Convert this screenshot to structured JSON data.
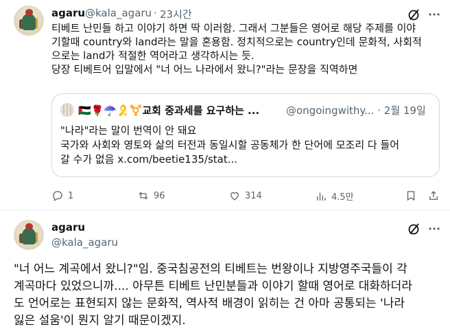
{
  "tweet1": {
    "name": "agaru",
    "handle": "@kala_agaru",
    "separator": "·",
    "time": "23시간",
    "lines": [
      "티베트 난민들 하고 이야기 하면 딱 이러함. 그래서 그분들은 영어로 해당 주제를 이야",
      "기할때 country와 land라는 말을 혼용함. 정치적으로는 country인데 문화적, 사회적",
      "으로는 land가 적절한 역어라고 생각하시는 듯.",
      "당장 티베트어 입말에서 \"너 어느 나라에서 왔니?\"라는 문장을 직역하면"
    ],
    "quote": {
      "name": "🇵🇸🌹☂️🎗️⚧️교회 중과세를 요구하는 ...",
      "handle": "@ongoingwithy...",
      "date": "· 2월 19일",
      "lines": [
        "\"나라\"라는 말이 번역이 안 돼요",
        "국가와 사회와 영토와 삶의 터전과 동일시할 공동체가 한 단어에 모조리 다 들어",
        "갈 수가 없음 x.com/beetie135/stat..."
      ]
    },
    "actions": {
      "replies": "1",
      "retweets": "96",
      "likes": "314",
      "views": "4.5만"
    }
  },
  "tweet2": {
    "name": "agaru",
    "handle": "@kala_agaru",
    "lines": [
      "\"너 어느 계곡에서 왔니?\"임. 중국침공전의 티베트는 번왕이나 지방영주국들이 각",
      "계곡마다 있었으니까.... 아무튼 티베트 난민분들과 이야기 할때 영어로 대화하더라",
      "도 언어로는 표현되지 않는 문화적, 역사적 배경이 읽히는 건 아마 공통되는 '나라",
      "잃은 설움'이 뭔지 알기 때문이겠지."
    ]
  },
  "icons": {
    "grok": "grok-icon",
    "more": "more-icon",
    "reply": "reply-icon",
    "retweet": "retweet-icon",
    "like": "like-icon",
    "views": "views-icon",
    "bookmark": "bookmark-icon",
    "share": "share-icon"
  },
  "colors": {
    "text": "#0f1419",
    "muted": "#536471",
    "border": "#cfd9de"
  }
}
